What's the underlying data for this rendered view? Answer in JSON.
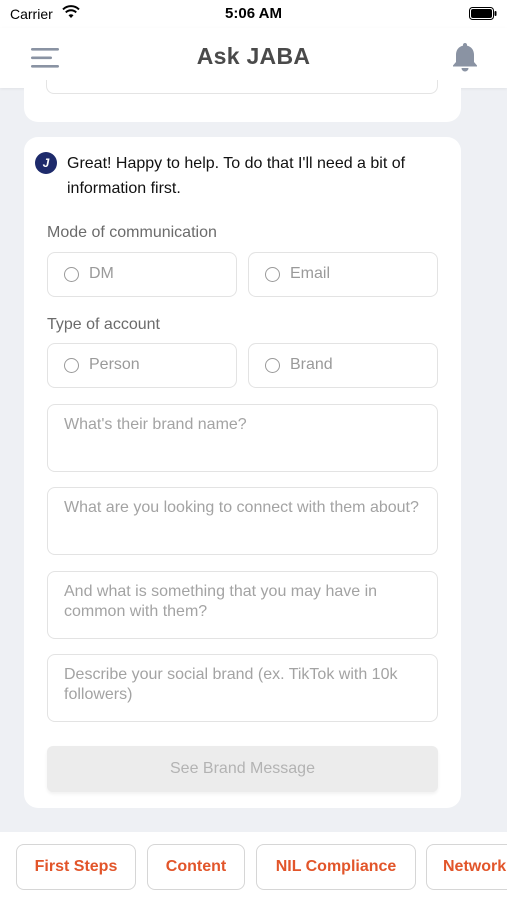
{
  "status_bar": {
    "carrier": "Carrier",
    "time": "5:06 AM"
  },
  "header": {
    "title": "Ask JABA",
    "menu_icon": "hamburger-menu-icon",
    "bell_icon": "bell-icon"
  },
  "chat": {
    "bot_avatar_glyph": "J",
    "bot_message": "Great! Happy to help. To do that I'll need a bit of information first.",
    "mode_section": {
      "label": "Mode of communication",
      "options": [
        "DM",
        "Email"
      ]
    },
    "account_section": {
      "label": "Type of account",
      "options": [
        "Person",
        "Brand"
      ]
    },
    "fields": [
      {
        "placeholder": "What's their brand name?"
      },
      {
        "placeholder": "What are you looking to connect with them about?"
      },
      {
        "placeholder": "And what is something that you may have in common with them?"
      },
      {
        "placeholder": "Describe your social brand (ex. TikTok with 10k followers)"
      }
    ],
    "submit_label": "See Brand Message",
    "submit_enabled": false
  },
  "quick_actions": {
    "accent_color": "#e2552a",
    "chips": [
      "First Steps",
      "Content",
      "NIL Compliance",
      "Network"
    ]
  }
}
